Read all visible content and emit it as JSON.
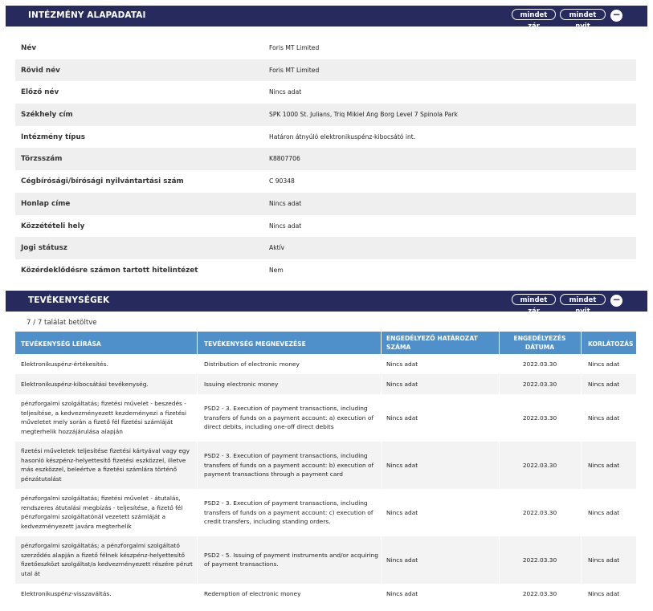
{
  "institution": {
    "title": "INTÉZMÉNY ALAPADATAI",
    "collapse_all": "mindet zár",
    "expand_all": "mindet nyit",
    "rows": [
      {
        "label": "Név",
        "value": "Foris MT Limited"
      },
      {
        "label": "Rövid név",
        "value": "Foris MT Limited"
      },
      {
        "label": "Előző név",
        "value": "Nincs adat"
      },
      {
        "label": "Székhely cím",
        "value": "SPK 1000 St. Julians, Triq Mikiel Ang Borg Level 7 Spinola Park"
      },
      {
        "label": "Intézmény típus",
        "value": "Határon átnyúló elektronikuspénz-kibocsátó int."
      },
      {
        "label": "Törzsszám",
        "value": "K8807706"
      },
      {
        "label": "Cégbírósági/bírósági nyilvántartási szám",
        "value": "C 90348"
      },
      {
        "label": "Honlap címe",
        "value": "Nincs adat"
      },
      {
        "label": "Közzétételi hely",
        "value": "Nincs adat"
      },
      {
        "label": "Jogi státusz",
        "value": "Aktív"
      },
      {
        "label": "Közérdeklődésre számon tartott hitelintézet",
        "value": "Nem"
      }
    ]
  },
  "activities": {
    "title": "TEVÉKENYSÉGEK",
    "collapse_all": "mindet zár",
    "expand_all": "mindet nyit",
    "count_text": "7 / 7 találat betöltve",
    "columns": {
      "description": "TEVÉKENYSÉG LEÍRÁSA",
      "name": "TEVÉKENYSÉG MEGNEVEZÉSE",
      "decision_no_1": "ENGEDÉLYEZŐ HATÁROZAT",
      "decision_no_2": "SZÁMA",
      "date_1": "ENGEDÉLYEZÉS",
      "date_2": "DÁTUMA",
      "restriction": "KORLÁTOZÁS"
    },
    "rows": [
      {
        "desc": [
          "Elektronikuspénz-értékesítés."
        ],
        "name": [
          "Distribution of electronic money"
        ],
        "decision": "Nincs adat",
        "date": "2022.03.30",
        "restriction": "Nincs adat"
      },
      {
        "desc": [
          "Elektronikuspénz-kibocsátási tevékenység."
        ],
        "name": [
          "Issuing electronic money"
        ],
        "decision": "Nincs adat",
        "date": "2022.03.30",
        "restriction": "Nincs adat"
      },
      {
        "desc": [
          "pénzforgalmi szolgáltatás; fizetési művelet - beszedés -",
          "teljesítése, a kedvezményezett kezdeményezi a fizetési",
          "műveletet mely során a fizető fél fizetési számláját",
          "megterhelik hozzájárulása alapján"
        ],
        "name": [
          "PSD2 - 3. Execution of payment transactions, including",
          "transfers of funds on a payment account: a) execution of",
          "direct debits, including one-off direct debits"
        ],
        "decision": "Nincs adat",
        "date": "2022.03.30",
        "restriction": "Nincs adat"
      },
      {
        "desc": [
          "fizetési műveletek teljesítése fizetési kártyával vagy egy",
          "hasonló készpénz-helyettesítő fizetési eszközzel, illetve",
          "más eszközzel, beleértve a fizetési számlára történő",
          "pénzátutalást"
        ],
        "name": [
          "PSD2 - 3. Execution of payment transactions, including",
          "transfers of funds on a payment account: b) execution of",
          "payment transactions through a payment card"
        ],
        "decision": "Nincs adat",
        "date": "2022.03.30",
        "restriction": "Nincs adat"
      },
      {
        "desc": [
          "pénzforgalmi szolgáltatás; fizetési művelet - átutalás,",
          "rendszeres átutalási megbízás - teljesítése, a fizető fél",
          "pénzforgalmi szolgáltatónál vezetett számláját a",
          "kedvezményezett javára megterhelik"
        ],
        "name": [
          "PSD2 - 3. Execution of payment transactions, including",
          "transfers of funds on a payment account: c) execution of",
          "credit transfers, including standing orders."
        ],
        "decision": "Nincs adat",
        "date": "2022.03.30",
        "restriction": "Nincs adat"
      },
      {
        "desc": [
          "pénzforgalmi szolgáltatás; a pénzforgalmi szolgáltató",
          "szerződés alapján a fizető félnek készpénz-helyettesítő",
          "fizetőeszközt szolgáltat/a kedvezményezett részére pénzt",
          "utal át"
        ],
        "name": [
          "PSD2 - 5. Issuing of payment instruments and/or acquiring",
          "of payment transactions."
        ],
        "decision": "Nincs adat",
        "date": "2022.03.30",
        "restriction": "Nincs adat"
      },
      {
        "desc": [
          "Elektronikuspénz-visszaváltás."
        ],
        "name": [
          "Redemption of electronic money"
        ],
        "decision": "Nincs adat",
        "date": "2022.03.30",
        "restriction": "Nincs adat"
      }
    ]
  }
}
